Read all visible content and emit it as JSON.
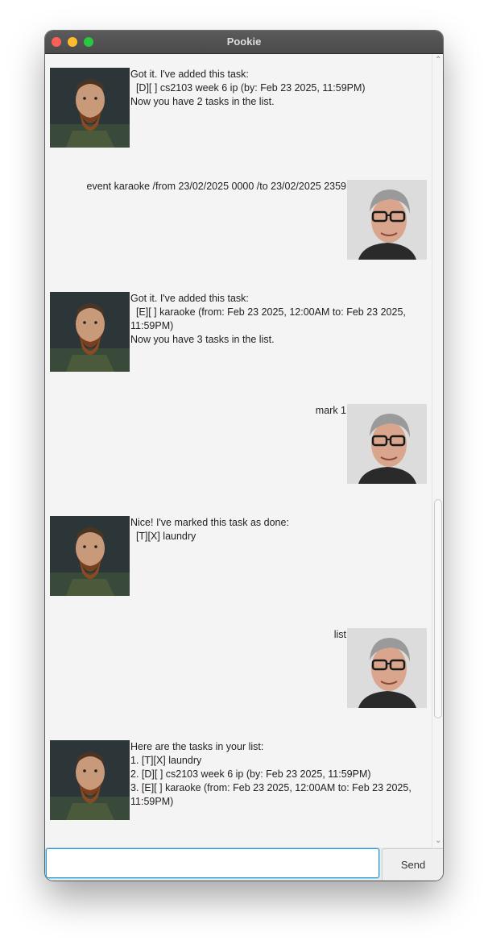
{
  "window": {
    "title": "Pookie"
  },
  "messages": [
    {
      "from": "bot",
      "text": "Got it. I've added this task:\n  [D][ ] cs2103 week 6 ip (by: Feb 23 2025, 11:59PM)\nNow you have 2 tasks in the list."
    },
    {
      "from": "user",
      "text": "event karaoke /from 23/02/2025 0000 /to 23/02/2025 2359"
    },
    {
      "from": "bot",
      "text": "Got it. I've added this task:\n  [E][ ] karaoke (from: Feb 23 2025, 12:00AM to: Feb 23 2025,\n11:59PM)\nNow you have 3 tasks in the list."
    },
    {
      "from": "user",
      "text": "mark 1"
    },
    {
      "from": "bot",
      "text": "Nice! I've marked this task as done:\n  [T][X] laundry"
    },
    {
      "from": "user",
      "text": "list"
    },
    {
      "from": "bot",
      "text": "Here are the tasks in your list:\n1. [T][X] laundry\n2. [D][ ] cs2103 week 6 ip (by: Feb 23 2025, 11:59PM)\n3. [E][ ] karaoke (from: Feb 23 2025, 12:00AM to: Feb 23 2025,\n11:59PM)"
    }
  ],
  "input": {
    "value": "",
    "placeholder": ""
  },
  "send_button": {
    "label": "Send"
  },
  "colors": {
    "input_focus": "#2a9fd6",
    "titlebar": "#4f4f4f",
    "chat_bg": "#f4f4f4"
  },
  "icons": {
    "bot_avatar": "bearded-man-avatar",
    "user_avatar": "man-with-glasses-avatar"
  }
}
